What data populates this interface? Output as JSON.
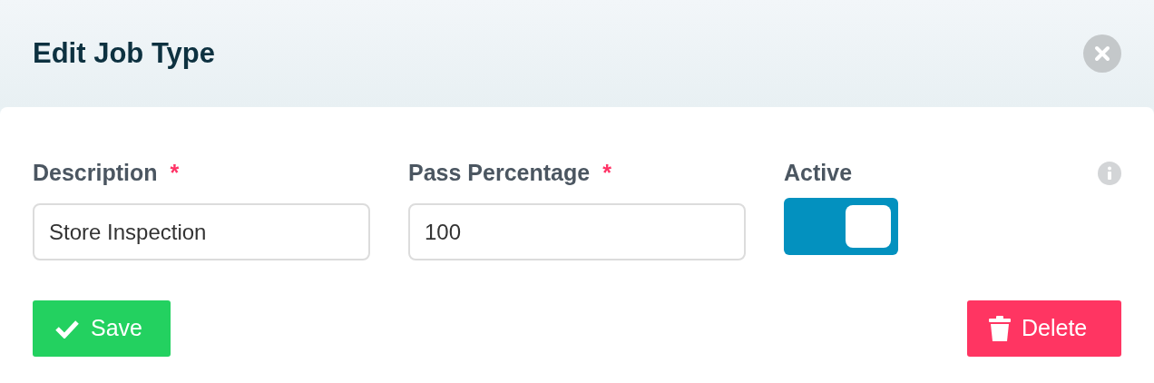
{
  "dialog": {
    "title": "Edit Job Type"
  },
  "fields": [
    {
      "kind": "text",
      "label": "Description",
      "required_mark": "*",
      "value": "Store Inspection"
    },
    {
      "kind": "text",
      "label": "Pass Percentage",
      "required_mark": "*",
      "value": "100"
    },
    {
      "kind": "toggle",
      "label": "Active",
      "on": true
    }
  ],
  "buttons": [
    {
      "kind": "save",
      "label": "Save"
    },
    {
      "kind": "delete",
      "label": "Delete"
    }
  ]
}
